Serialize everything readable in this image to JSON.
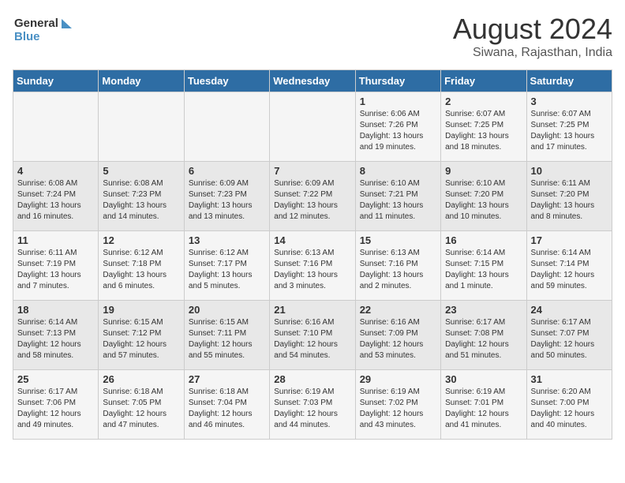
{
  "header": {
    "logo_line1": "General",
    "logo_line2": "Blue",
    "month_year": "August 2024",
    "location": "Siwana, Rajasthan, India"
  },
  "days_of_week": [
    "Sunday",
    "Monday",
    "Tuesday",
    "Wednesday",
    "Thursday",
    "Friday",
    "Saturday"
  ],
  "weeks": [
    [
      {
        "day": "",
        "info": ""
      },
      {
        "day": "",
        "info": ""
      },
      {
        "day": "",
        "info": ""
      },
      {
        "day": "",
        "info": ""
      },
      {
        "day": "1",
        "info": "Sunrise: 6:06 AM\nSunset: 7:26 PM\nDaylight: 13 hours\nand 19 minutes."
      },
      {
        "day": "2",
        "info": "Sunrise: 6:07 AM\nSunset: 7:25 PM\nDaylight: 13 hours\nand 18 minutes."
      },
      {
        "day": "3",
        "info": "Sunrise: 6:07 AM\nSunset: 7:25 PM\nDaylight: 13 hours\nand 17 minutes."
      }
    ],
    [
      {
        "day": "4",
        "info": "Sunrise: 6:08 AM\nSunset: 7:24 PM\nDaylight: 13 hours\nand 16 minutes."
      },
      {
        "day": "5",
        "info": "Sunrise: 6:08 AM\nSunset: 7:23 PM\nDaylight: 13 hours\nand 14 minutes."
      },
      {
        "day": "6",
        "info": "Sunrise: 6:09 AM\nSunset: 7:23 PM\nDaylight: 13 hours\nand 13 minutes."
      },
      {
        "day": "7",
        "info": "Sunrise: 6:09 AM\nSunset: 7:22 PM\nDaylight: 13 hours\nand 12 minutes."
      },
      {
        "day": "8",
        "info": "Sunrise: 6:10 AM\nSunset: 7:21 PM\nDaylight: 13 hours\nand 11 minutes."
      },
      {
        "day": "9",
        "info": "Sunrise: 6:10 AM\nSunset: 7:20 PM\nDaylight: 13 hours\nand 10 minutes."
      },
      {
        "day": "10",
        "info": "Sunrise: 6:11 AM\nSunset: 7:20 PM\nDaylight: 13 hours\nand 8 minutes."
      }
    ],
    [
      {
        "day": "11",
        "info": "Sunrise: 6:11 AM\nSunset: 7:19 PM\nDaylight: 13 hours\nand 7 minutes."
      },
      {
        "day": "12",
        "info": "Sunrise: 6:12 AM\nSunset: 7:18 PM\nDaylight: 13 hours\nand 6 minutes."
      },
      {
        "day": "13",
        "info": "Sunrise: 6:12 AM\nSunset: 7:17 PM\nDaylight: 13 hours\nand 5 minutes."
      },
      {
        "day": "14",
        "info": "Sunrise: 6:13 AM\nSunset: 7:16 PM\nDaylight: 13 hours\nand 3 minutes."
      },
      {
        "day": "15",
        "info": "Sunrise: 6:13 AM\nSunset: 7:16 PM\nDaylight: 13 hours\nand 2 minutes."
      },
      {
        "day": "16",
        "info": "Sunrise: 6:14 AM\nSunset: 7:15 PM\nDaylight: 13 hours\nand 1 minute."
      },
      {
        "day": "17",
        "info": "Sunrise: 6:14 AM\nSunset: 7:14 PM\nDaylight: 12 hours\nand 59 minutes."
      }
    ],
    [
      {
        "day": "18",
        "info": "Sunrise: 6:14 AM\nSunset: 7:13 PM\nDaylight: 12 hours\nand 58 minutes."
      },
      {
        "day": "19",
        "info": "Sunrise: 6:15 AM\nSunset: 7:12 PM\nDaylight: 12 hours\nand 57 minutes."
      },
      {
        "day": "20",
        "info": "Sunrise: 6:15 AM\nSunset: 7:11 PM\nDaylight: 12 hours\nand 55 minutes."
      },
      {
        "day": "21",
        "info": "Sunrise: 6:16 AM\nSunset: 7:10 PM\nDaylight: 12 hours\nand 54 minutes."
      },
      {
        "day": "22",
        "info": "Sunrise: 6:16 AM\nSunset: 7:09 PM\nDaylight: 12 hours\nand 53 minutes."
      },
      {
        "day": "23",
        "info": "Sunrise: 6:17 AM\nSunset: 7:08 PM\nDaylight: 12 hours\nand 51 minutes."
      },
      {
        "day": "24",
        "info": "Sunrise: 6:17 AM\nSunset: 7:07 PM\nDaylight: 12 hours\nand 50 minutes."
      }
    ],
    [
      {
        "day": "25",
        "info": "Sunrise: 6:17 AM\nSunset: 7:06 PM\nDaylight: 12 hours\nand 49 minutes."
      },
      {
        "day": "26",
        "info": "Sunrise: 6:18 AM\nSunset: 7:05 PM\nDaylight: 12 hours\nand 47 minutes."
      },
      {
        "day": "27",
        "info": "Sunrise: 6:18 AM\nSunset: 7:04 PM\nDaylight: 12 hours\nand 46 minutes."
      },
      {
        "day": "28",
        "info": "Sunrise: 6:19 AM\nSunset: 7:03 PM\nDaylight: 12 hours\nand 44 minutes."
      },
      {
        "day": "29",
        "info": "Sunrise: 6:19 AM\nSunset: 7:02 PM\nDaylight: 12 hours\nand 43 minutes."
      },
      {
        "day": "30",
        "info": "Sunrise: 6:19 AM\nSunset: 7:01 PM\nDaylight: 12 hours\nand 41 minutes."
      },
      {
        "day": "31",
        "info": "Sunrise: 6:20 AM\nSunset: 7:00 PM\nDaylight: 12 hours\nand 40 minutes."
      }
    ]
  ]
}
